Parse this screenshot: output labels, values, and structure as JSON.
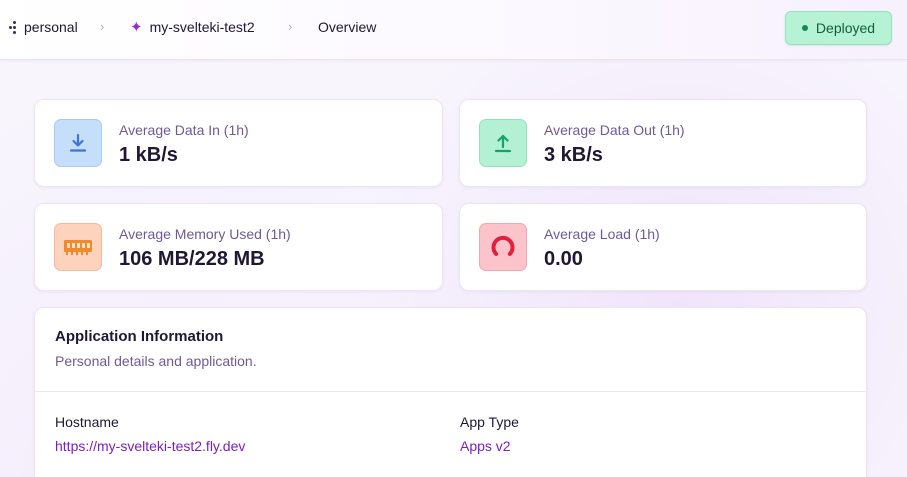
{
  "breadcrumb": {
    "org": "personal",
    "app": "my-svelteki-test2",
    "page": "Overview"
  },
  "status": {
    "label": "Deployed",
    "color": "#b6f2d4"
  },
  "stats": [
    {
      "label": "Average Data In (1h)",
      "value": "1 kB/s",
      "icon": "download-icon"
    },
    {
      "label": "Average Data Out (1h)",
      "value": "3 kB/s",
      "icon": "upload-icon"
    },
    {
      "label": "Average Memory Used (1h)",
      "value": "106 MB/228 MB",
      "icon": "memory-icon"
    },
    {
      "label": "Average Load (1h)",
      "value": "0.00",
      "icon": "gauge-icon"
    }
  ],
  "app_info": {
    "title": "Application Information",
    "subtitle": "Personal details and application.",
    "fields": [
      {
        "label": "Hostname",
        "value": "https://my-svelteki-test2.fly.dev"
      },
      {
        "label": "App Type",
        "value": "Apps v2"
      }
    ]
  },
  "colors": {
    "accent": "#9b24e0",
    "link": "#7a1fbf"
  }
}
